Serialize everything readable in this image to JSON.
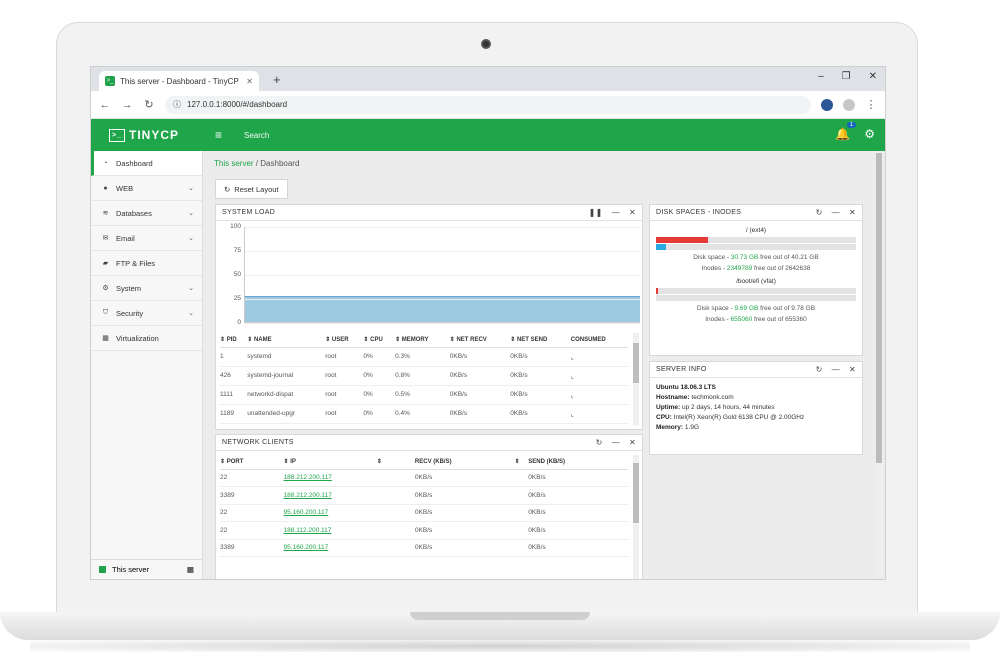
{
  "browser": {
    "tab_title": "This server - Dashboard - TinyCP",
    "new_tab": "+",
    "url": "127.0.0.1:8000/#/dashboard",
    "window_controls": [
      "–",
      "❐",
      "✕"
    ]
  },
  "header": {
    "logo_text": "TINYCP",
    "search_label": "Search",
    "notification_count": "1"
  },
  "sidebar": {
    "items": [
      {
        "label": "Dashboard",
        "icon": "dashboard-icon",
        "chevron": ""
      },
      {
        "label": "WEB",
        "icon": "globe-icon",
        "chevron": "⌄"
      },
      {
        "label": "Databases",
        "icon": "database-icon",
        "chevron": "⌄"
      },
      {
        "label": "Email",
        "icon": "envelope-icon",
        "chevron": "⌄"
      },
      {
        "label": "FTP & Files",
        "icon": "folder-icon",
        "chevron": ""
      },
      {
        "label": "System",
        "icon": "gear-icon",
        "chevron": "⌄"
      },
      {
        "label": "Security",
        "icon": "shield-icon",
        "chevron": "⌄"
      },
      {
        "label": "Virtualization",
        "icon": "grid-icon",
        "chevron": ""
      }
    ],
    "server_label": "This server"
  },
  "breadcrumb": {
    "root": "This server",
    "separator": "/",
    "current": "Dashboard"
  },
  "reset_layout": "Reset Layout",
  "system_load": {
    "title": "SYSTEM LOAD",
    "yticks": [
      "100",
      "75",
      "50",
      "25",
      "0"
    ],
    "columns": [
      "⇕ PID",
      "⇕ NAME",
      "⇕ USER",
      "⇕ CPU",
      "⇕ MEMORY",
      "⇕ NET RECV",
      "⇕ NET SEND",
      "CONSUMED"
    ],
    "rows": [
      [
        "1",
        "systemd",
        "root",
        "0%",
        "0.3%",
        "0KB/s",
        "0KB/s",
        "⌞"
      ],
      [
        "426",
        "systemd-journal",
        "root",
        "0%",
        "0.8%",
        "0KB/s",
        "0KB/s",
        "⌞"
      ],
      [
        "1111",
        "networkd-dispat",
        "root",
        "0%",
        "0.5%",
        "0KB/s",
        "0KB/s",
        "⌞"
      ],
      [
        "1189",
        "unattended-upgr",
        "root",
        "0%",
        "0.4%",
        "0KB/s",
        "0KB/s",
        "⌞"
      ]
    ]
  },
  "network_clients": {
    "title": "NETWORK CLIENTS",
    "columns": [
      "⇕ PORT",
      "⇕ IP",
      "⇕",
      "RECV (KB/S)",
      "⇕",
      "SEND (KB/S)"
    ],
    "rows": [
      [
        "22",
        "188.212.200.117",
        "0KB/s",
        "0KB/s"
      ],
      [
        "3389",
        "188.212.200.117",
        "0KB/s",
        "0KB/s"
      ],
      [
        "22",
        "95.160.200.117",
        "0KB/s",
        "0KB/s"
      ],
      [
        "22",
        "188.112.200.117",
        "0KB/s",
        "0KB/s"
      ],
      [
        "3389",
        "95.160.200.117",
        "0KB/s",
        "0KB/s"
      ]
    ]
  },
  "disk_spaces": {
    "title": "DISK SPACES - INODES",
    "mounts": [
      {
        "name": "/ (ext4)",
        "space_fraction": 0.26,
        "inode_fraction": 0.05,
        "disk_prefix": "Disk space - ",
        "disk_free": "30.73 GB",
        "disk_suffix": " free out of 40.21 GB",
        "inode_prefix": "Inodes - ",
        "inode_free": "2349789",
        "inode_suffix": " free out of 2642638"
      },
      {
        "name": "/boot/efi (vfat)",
        "space_fraction": 0.01,
        "inode_fraction": 0,
        "disk_prefix": "Disk space - ",
        "disk_free": "9.69 GB",
        "disk_suffix": " free out of 9.78 GB",
        "inode_prefix": "Inodes - ",
        "inode_free": "655060",
        "inode_suffix": " free out of 655360"
      }
    ]
  },
  "server_info": {
    "title": "SERVER INFO",
    "os": "Ubuntu 18.06.3 LTS",
    "hostname_label": "Hostname:",
    "hostname": "techmonk.com",
    "uptime_label": "Uptime:",
    "uptime": "up 2 days, 14 hours, 44 minutes",
    "cpu_label": "CPU:",
    "cpu": "Intel(R) Xeon(R) Gold 6138 CPU @ 2.00GHz",
    "memory_label": "Memory:",
    "memory": "1.9G"
  },
  "colors": {
    "brand": "#1fa54a",
    "disk_used": "#e53935",
    "inode_used": "#29a9e1",
    "load_fill": "#9ec9e3"
  },
  "load_level_percent": 27
}
